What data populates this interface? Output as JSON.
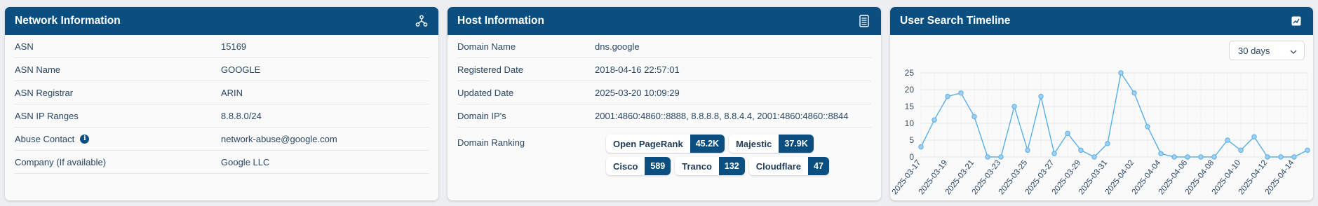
{
  "network": {
    "title": "Network Information",
    "icon": "network-icon",
    "rows": [
      {
        "label": "ASN",
        "value": "15169"
      },
      {
        "label": "ASN Name",
        "value": "GOOGLE"
      },
      {
        "label": "ASN Registrar",
        "value": "ARIN"
      },
      {
        "label": "ASN IP Ranges",
        "value": "8.8.8.0/24"
      },
      {
        "label": "Abuse Contact",
        "value": "network-abuse@google.com"
      },
      {
        "label": "Company (If available)",
        "value": "Google LLC"
      }
    ]
  },
  "host": {
    "title": "Host Information",
    "icon": "server-icon",
    "rows": [
      {
        "label": "Domain Name",
        "value": "dns.google"
      },
      {
        "label": "Registered Date",
        "value": "2018-04-16 22:57:01"
      },
      {
        "label": "Updated Date",
        "value": "2025-03-20 10:09:29"
      },
      {
        "label": "Domain IP's",
        "value": "2001:4860:4860::8888, 8.8.8.8, 8.8.4.4, 2001:4860:4860::8844"
      }
    ],
    "ranking_label": "Domain Ranking",
    "rankings": [
      {
        "name": "Open PageRank",
        "value": "45.2K"
      },
      {
        "name": "Majestic",
        "value": "37.9K"
      },
      {
        "name": "Cisco",
        "value": "589"
      },
      {
        "name": "Tranco",
        "value": "132"
      },
      {
        "name": "Cloudflare",
        "value": "47"
      }
    ]
  },
  "timeline": {
    "title": "User Search Timeline",
    "icon": "chart-icon",
    "range_value": "30 days"
  },
  "chart_data": {
    "type": "line",
    "x": [
      "2025-03-17",
      "2025-03-18",
      "2025-03-19",
      "2025-03-20",
      "2025-03-21",
      "2025-03-22",
      "2025-03-23",
      "2025-03-24",
      "2025-03-25",
      "2025-03-26",
      "2025-03-27",
      "2025-03-28",
      "2025-03-29",
      "2025-03-30",
      "2025-03-31",
      "2025-04-01",
      "2025-04-02",
      "2025-04-03",
      "2025-04-04",
      "2025-04-05",
      "2025-04-06",
      "2025-04-07",
      "2025-04-08",
      "2025-04-09",
      "2025-04-10",
      "2025-04-11",
      "2025-04-12",
      "2025-04-13",
      "2025-04-14",
      "2025-04-15"
    ],
    "x_tick_labels": [
      "2025-03-17",
      "2025-03-19",
      "2025-03-21",
      "2025-03-23",
      "2025-03-25",
      "2025-03-27",
      "2025-03-29",
      "2025-03-31",
      "2025-04-02",
      "2025-04-04",
      "2025-04-06",
      "2025-04-08",
      "2025-04-10",
      "2025-04-12",
      "2025-04-14"
    ],
    "y": [
      3,
      11,
      18,
      19,
      12,
      0,
      0,
      15,
      2,
      18,
      1,
      7,
      2,
      0,
      4,
      25,
      19,
      9,
      1,
      0,
      0,
      0,
      0,
      5,
      2,
      6,
      0,
      0,
      0,
      2
    ],
    "ylim": [
      0,
      25
    ],
    "yticks": [
      0,
      5,
      10,
      15,
      20,
      25
    ],
    "grid": true,
    "line_color": "#5aaee6",
    "point_color": "#9fd0f3"
  }
}
